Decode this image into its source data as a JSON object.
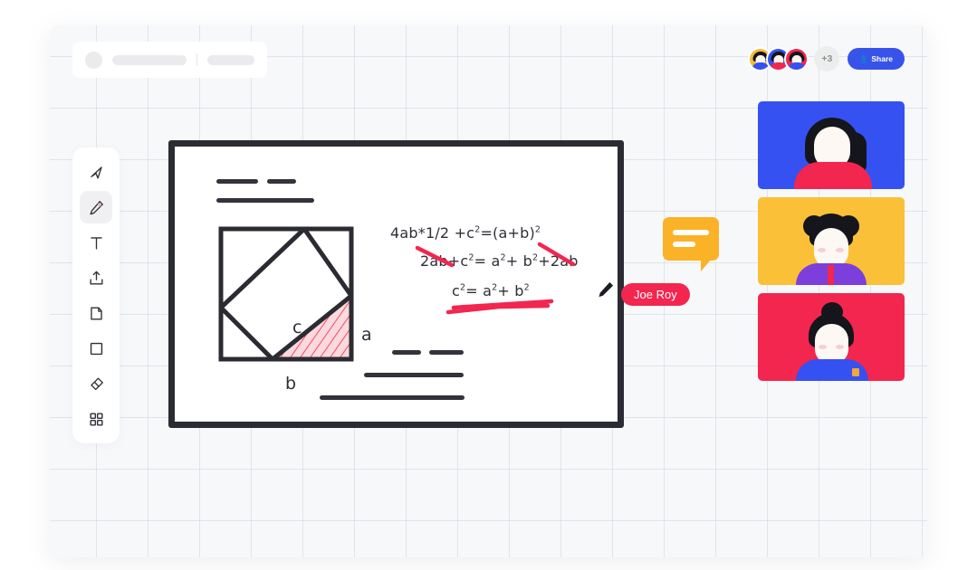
{
  "app": {
    "background_color": "#ffffff",
    "canvas_background": "#f7f8fa",
    "grid_color": "#cdd4de"
  },
  "header_skeleton": {
    "name": "loading-placeholder-header",
    "has_avatar_circle": true,
    "bar_long": "",
    "bar_short": ""
  },
  "participants": {
    "avatars": [
      {
        "name": "participant-avatar-1",
        "bg": "#f6b93b",
        "body": "#3551f1"
      },
      {
        "name": "participant-avatar-2",
        "bg": "#3551f1",
        "body": "#f2264f"
      },
      {
        "name": "participant-avatar-3",
        "bg": "#f2264f",
        "body": "#3551f1"
      }
    ],
    "overflow_count": "+3",
    "share_button_label": "Share",
    "share_button_color": "#3853ea"
  },
  "toolbar": {
    "active_tool": "pencil",
    "tools": [
      {
        "id": "cursor",
        "icon": "cursor-arrow-icon",
        "label": "Select"
      },
      {
        "id": "pencil",
        "icon": "pencil-icon",
        "label": "Draw"
      },
      {
        "id": "text",
        "icon": "text-icon",
        "label": "Text"
      },
      {
        "id": "upload",
        "icon": "upload-icon",
        "label": "Upload"
      },
      {
        "id": "note",
        "icon": "note-icon",
        "label": "Sticky note"
      },
      {
        "id": "shape",
        "icon": "square-icon",
        "label": "Shape"
      },
      {
        "id": "eraser",
        "icon": "eraser-icon",
        "label": "Eraser"
      },
      {
        "id": "apps",
        "icon": "grid-apps-icon",
        "label": "More tools"
      }
    ]
  },
  "whiteboard": {
    "frame_color": "#2b2b33",
    "board_color": "#ffffff",
    "equations": [
      {
        "id": "eq1",
        "text": "4ab*1/2 +c²=(a+b)²"
      },
      {
        "id": "eq2",
        "text": "2ab+c²= a²+ b²+2ab"
      },
      {
        "id": "eq3",
        "text": "c²= a²+ b²"
      }
    ],
    "annotation_color": "#f2264f",
    "diagram": {
      "name": "pythagorean-theorem-diagram",
      "labels": {
        "hypotenuse": "c",
        "vertical_leg": "a",
        "horizontal_leg": "b"
      },
      "shaded_triangle_fill": "#fbd9dd",
      "hatch_color": "#f2264f",
      "stroke_color": "#2b2b33"
    }
  },
  "cursor": {
    "user_name": "Joe Roy",
    "color": "#f2264f",
    "icon": "pencil-cursor-icon"
  },
  "chat_bubble": {
    "name": "chat-message-bubble",
    "color": "#fcb226",
    "lines": 2
  },
  "video_tiles": [
    {
      "id": "tile-1",
      "name": "video-tile-participant-1",
      "bg": "#3551f1",
      "shirt": "#f2264f",
      "hair_style": "ponytail"
    },
    {
      "id": "tile-2",
      "name": "video-tile-participant-2",
      "bg": "#fac038",
      "shirt": "#7d3fdb",
      "hair_style": "double-buns"
    },
    {
      "id": "tile-3",
      "name": "video-tile-participant-3",
      "bg": "#f2264f",
      "shirt": "#3551f1",
      "hair_style": "top-bun"
    }
  ]
}
